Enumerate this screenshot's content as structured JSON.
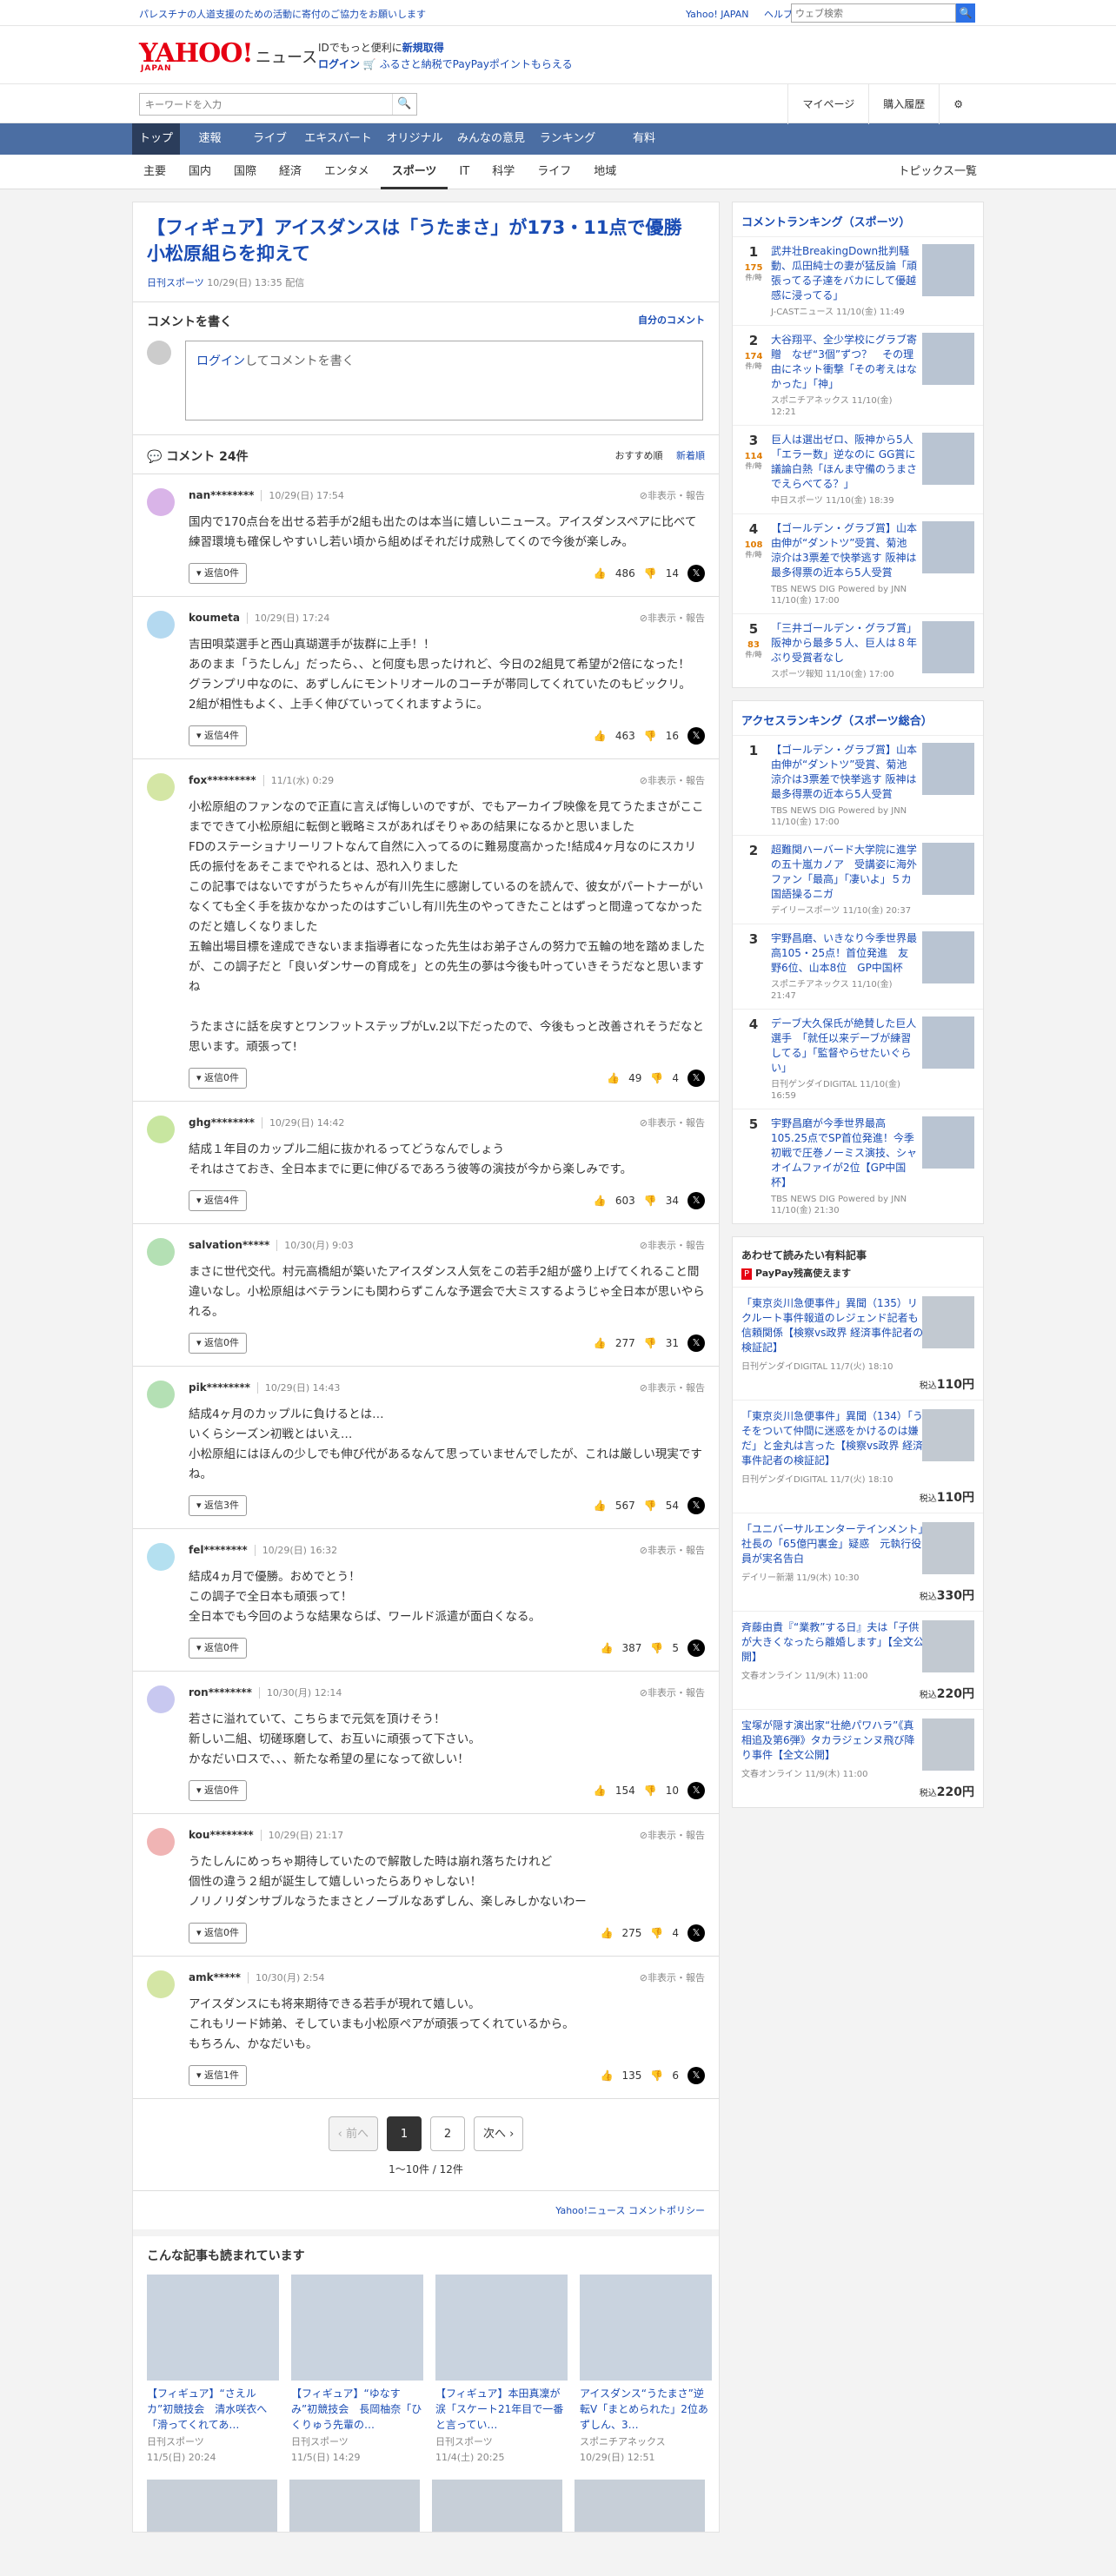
{
  "topstrip": {
    "notice": "パレスチナの人道支援のための活動に寄付のご協力をお願いします",
    "links": [
      "Yahoo! JAPAN",
      "ヘルプ"
    ],
    "search_placeholder": "ウェブ検索"
  },
  "header": {
    "logo": "YAHOO!",
    "logo_sub": "JAPAN",
    "service": "ニュース",
    "promo_line1_a": "IDでもっと便利に",
    "promo_line1_b": "新規取得",
    "promo_login": "ログイン",
    "promo_line2": "ふるさと納税でPayPayポイントもらえる"
  },
  "searchbar": {
    "placeholder": "キーワードを入力",
    "right": [
      "マイページ",
      "購入履歴"
    ]
  },
  "mainnav": [
    "トップ",
    "速報",
    "ライブ",
    "エキスパート",
    "オリジナル",
    "みんなの意見",
    "ランキング",
    "有料"
  ],
  "subnav": {
    "items": [
      "主要",
      "国内",
      "国際",
      "経済",
      "エンタメ",
      "スポーツ",
      "IT",
      "科学",
      "ライフ",
      "地域"
    ],
    "active": "スポーツ",
    "topics": "トピックス一覧"
  },
  "article": {
    "title": "【フィギュア】アイスダンスは「うたまさ」が173・11点で優勝 小松原組らを抑えて",
    "source": "日刊スポーツ",
    "date": "10/29(日) 13:35 配信"
  },
  "write": {
    "heading": "コメントを書く",
    "mine": "自分のコメント",
    "login": "ログイン",
    "placeholder": "してコメントを書く"
  },
  "comments_header": {
    "title": "コメント 24件",
    "sort_recommended": "おすすめ順",
    "sort_new": "新着順"
  },
  "report_label": "非表示・報告",
  "comments": [
    {
      "name": "nan********",
      "date": "10/29(日) 17:54",
      "text": "国内で170点台を出せる若手が2組も出たのは本当に嬉しいニュース。アイスダンスペアに比べて練習環境も確保しやすいし若い頃から組めばそれだけ成熟してくので今後が楽しみ。",
      "replies": "返信0件",
      "up": "486",
      "down": "14",
      "color": "#d9b4e8"
    },
    {
      "name": "koumeta",
      "date": "10/29(日) 17:24",
      "text": "吉田唄菜選手と西山真瑚選手が抜群に上手！！\nあのまま「うたしん」だったら、、と何度も思ったけれど、今日の2組見て希望が2倍になった！\nグランプリ中なのに、あずしんにモントリオールのコーチが帯同してくれていたのもビックリ。\n2組が相性もよく、上手く伸びていってくれますように。",
      "replies": "返信4件",
      "up": "463",
      "down": "16",
      "color": "#b4d9f0"
    },
    {
      "name": "fox*********",
      "date": "11/1(水) 0:29",
      "text": "小松原組のファンなので正直に言えば悔しいのですが、でもアーカイブ映像を見てうたまさがここまでできて小松原組に転倒と戦略ミスがあればそりゃあの結果になるかと思いました\nFDのステーショナリーリフトなんて自然に入ってるのに難易度高かった!結成4ヶ月なのにスカリ氏の振付をあそこまでやれるとは、恐れ入りました\nこの記事ではないですがうたちゃんが有川先生に感謝しているのを読んで、彼女がパートナーがいなくても全く手を抜かなかったのはすごいし有川先生のやってきたことはずっと間違ってなかったのだと嬉しくなりました\n五輪出場目標を達成できないまま指導者になった先生はお弟子さんの努力で五輪の地を踏めましたが、この調子だと「良いダンサーの育成を」との先生の夢は今後も叶っていきそうだなと思いますね\n\nうたまさに話を戻すとワンフットステップがLv.2以下だったので、今後もっと改善されそうだなと思います。頑張って!",
      "replies": "返信0件",
      "up": "49",
      "down": "4",
      "color": "#d4e6a5"
    },
    {
      "name": "ghg********",
      "date": "10/29(日) 14:42",
      "text": "結成１年目のカップル二組に抜かれるってどうなんでしょう\nそれはさておき、全日本までに更に伸びるであろう彼等の演技が今から楽しみです。",
      "replies": "返信4件",
      "up": "603",
      "down": "34",
      "color": "#c8e6a0"
    },
    {
      "name": "salvation*****",
      "date": "10/30(月) 9:03",
      "text": "まさに世代交代。村元高橋組が築いたアイスダンス人気をこの若手2組が盛り上げてくれること間違いなし。小松原組はベテランにも関わらずこんな予選会で大ミスするようじゃ全日本が思いやられる。",
      "replies": "返信0件",
      "up": "277",
      "down": "31",
      "color": "#b4e0b4"
    },
    {
      "name": "pik********",
      "date": "10/29(日) 14:43",
      "text": "結成4ヶ月のカップルに負けるとは…\nいくらシーズン初戦とはいえ…\n小松原組にはほんの少しでも伸び代があるなんて思っていませんでしたが、これは厳しい現実ですね。",
      "replies": "返信3件",
      "up": "567",
      "down": "54",
      "color": "#b4e0b4"
    },
    {
      "name": "fel********",
      "date": "10/29(日) 16:32",
      "text": "結成4ヵ月で優勝。おめでとう！\nこの調子で全日本も頑張って！\n全日本でも今回のような結果ならば、ワールド派遣が面白くなる。",
      "replies": "返信0件",
      "up": "387",
      "down": "5",
      "color": "#b4e0f0"
    },
    {
      "name": "ron********",
      "date": "10/30(月) 12:14",
      "text": "若さに溢れていて、こちらまで元気を頂けそう！\n新しい二組、切磋琢磨して、お互いに頑張って下さい。\nかなだいロスで、、、新たな希望の星になって欲しい！",
      "replies": "返信0件",
      "up": "154",
      "down": "10",
      "color": "#c8c8f0"
    },
    {
      "name": "kou********",
      "date": "10/29(日) 21:17",
      "text": "うたしんにめっちゃ期待していたので解散した時は崩れ落ちたけれど\n個性の違う２組が誕生して嬉しいったらありゃしない！\nノリノリダンサブルなうたまさとノーブルなあずしん、楽しみしかないわー",
      "replies": "返信0件",
      "up": "275",
      "down": "4",
      "color": "#f0b4b4"
    },
    {
      "name": "amk*****",
      "date": "10/30(月) 2:54",
      "text": "アイスダンスにも将来期待できる若手が現れて嬉しい。\nこれもリード姉弟、そしていまも小松原ペアが頑張ってくれているから。\nもちろん、かなだいも。",
      "replies": "返信1件",
      "up": "135",
      "down": "6",
      "color": "#d4e6a5"
    }
  ],
  "pager": {
    "prev": "前へ",
    "pages": [
      "1",
      "2"
    ],
    "current": "1",
    "next": "次へ",
    "count": "1〜10件 / 12件"
  },
  "policy": "Yahoo!ニュース コメントポリシー",
  "related": {
    "heading": "こんな記事も読まれています",
    "items": [
      {
        "title": "【フィギュア】“さえルカ”初競技会　清水咲衣へ「滑ってくれてあ…",
        "source": "日刊スポーツ",
        "date": "11/5(日) 20:24"
      },
      {
        "title": "【フィギュア】“ゆなすみ”初競技会　長岡柚奈「ひくりゅう先輩の…",
        "source": "日刊スポーツ",
        "date": "11/5(日) 14:29"
      },
      {
        "title": "【フィギュア】本田真凜が涙「スケート21年目で一番と言ってい…",
        "source": "日刊スポーツ",
        "date": "11/4(土) 20:25"
      },
      {
        "title": "アイスダンス“うたまさ”逆転V「まとめられた」2位あずしん、3…",
        "source": "スポニチアネックス",
        "date": "10/29(日) 12:51"
      }
    ]
  },
  "side": {
    "comment_ranking": {
      "heading": "コメントランキング（スポーツ）",
      "unit": "件/時",
      "items": [
        {
          "rank": "1",
          "count": "175",
          "title": "武井壮BreakingDown批判騒動、瓜田純士の妻が猛反論「頑張ってる子達をバカにして優越感に浸ってる」",
          "source": "J-CASTニュース",
          "date": "11/10(金) 11:49"
        },
        {
          "rank": "2",
          "count": "174",
          "title": "大谷翔平、全少学校にグラブ寄贈　なぜ“3個”ずつ？　その理由にネット衝撃「その考えはなかった」「神」",
          "source": "スポニチアネックス",
          "date": "11/10(金) 12:21"
        },
        {
          "rank": "3",
          "count": "114",
          "title": "巨人は選出ゼロ、阪神から5人「エラー数」逆なのに GG賞に議論白熱「ほんま守備のうまさでえらべてる？」",
          "source": "中日スポーツ",
          "date": "11/10(金) 18:39"
        },
        {
          "rank": "4",
          "count": "108",
          "title": "【ゴールデン・グラブ賞】山本由伸が“ダントツ”受賞、菊池涼介は3票差で快挙逃す 阪神は最多得票の近本ら5人受賞",
          "source": "TBS NEWS DIG Powered by JNN",
          "date": "11/10(金) 17:00"
        },
        {
          "rank": "5",
          "count": "83",
          "title": "「三井ゴールデン・グラブ賞」阪神から最多５人、巨人は８年ぶり受賞者なし",
          "source": "スポーツ報知",
          "date": "11/10(金) 17:00"
        }
      ]
    },
    "access_ranking": {
      "heading": "アクセスランキング（スポーツ総合）",
      "items": [
        {
          "rank": "1",
          "title": "【ゴールデン・グラブ賞】山本由伸が“ダントツ”受賞、菊池涼介は3票差で快挙逃す 阪神は最多得票の近本ら5人受賞",
          "source": "TBS NEWS DIG Powered by JNN",
          "date": "11/10(金) 17:00"
        },
        {
          "rank": "2",
          "title": "超難関ハーバード大学院に進学の五十嵐カノア　受講姿に海外ファン「最高」「凄いよ」５カ国語操るニガ",
          "source": "デイリースポーツ",
          "date": "11/10(金) 20:37"
        },
        {
          "rank": "3",
          "title": "宇野昌磨、いきなり今季世界最高105・25点！首位発進　友野6位、山本8位　GP中国杯",
          "source": "スポニチアネックス",
          "date": "11/10(金) 21:47"
        },
        {
          "rank": "4",
          "title": "デーブ大久保氏が絶賛した巨人選手　「就任以来デーブが練習してる」「監督やらせたいぐらい」",
          "source": "日刊ゲンダイDIGITAL",
          "date": "11/10(金) 16:59"
        },
        {
          "rank": "5",
          "title": "宇野昌磨が今季世界最高105.25点でSP首位発進！今季初戦で圧巻ノーミス演技、シャオイムファイが2位【GP中国杯】",
          "source": "TBS NEWS DIG Powered by JNN",
          "date": "11/10(金) 21:30"
        }
      ]
    },
    "paid": {
      "heading": "あわせて読みたい有料記事",
      "paypay": "PayPay残高使えます",
      "tax": "税込",
      "items": [
        {
          "title": "「東京炎川急便事件」異聞（135）リクルート事件報道のレジェンド記者も信頼関係【検察vs政界 経済事件記者の検証記】",
          "source": "日刊ゲンダイDIGITAL",
          "date": "11/7(火) 18:10",
          "price": "110円"
        },
        {
          "title": "「東京炎川急便事件」異聞（134）「うそをついて仲間に迷惑をかけるのは嫌だ」と金丸は言った【検察vs政界 経済事件記者の検証記】",
          "source": "日刊ゲンダイDIGITAL",
          "date": "11/7(火) 18:10",
          "price": "110円"
        },
        {
          "title": "「ユニバーサルエンターテインメント」社長の「65億円裏金」疑惑　元執行役員が実名告白",
          "source": "デイリー新潮",
          "date": "11/9(木) 10:30",
          "price": "330円"
        },
        {
          "title": "斉藤由貴『“業教”する日』夫は「子供が大きくなったら離婚します」【全文公開】",
          "source": "文春オンライン",
          "date": "11/9(木) 11:00",
          "price": "220円"
        },
        {
          "title": "宝塚が隠す演出家“壮絶パワハラ”《真相追及第6弾》タカラジェンヌ飛び降り事件【全文公開】",
          "source": "文春オンライン",
          "date": "11/9(木) 11:00",
          "price": "220円"
        }
      ]
    }
  }
}
